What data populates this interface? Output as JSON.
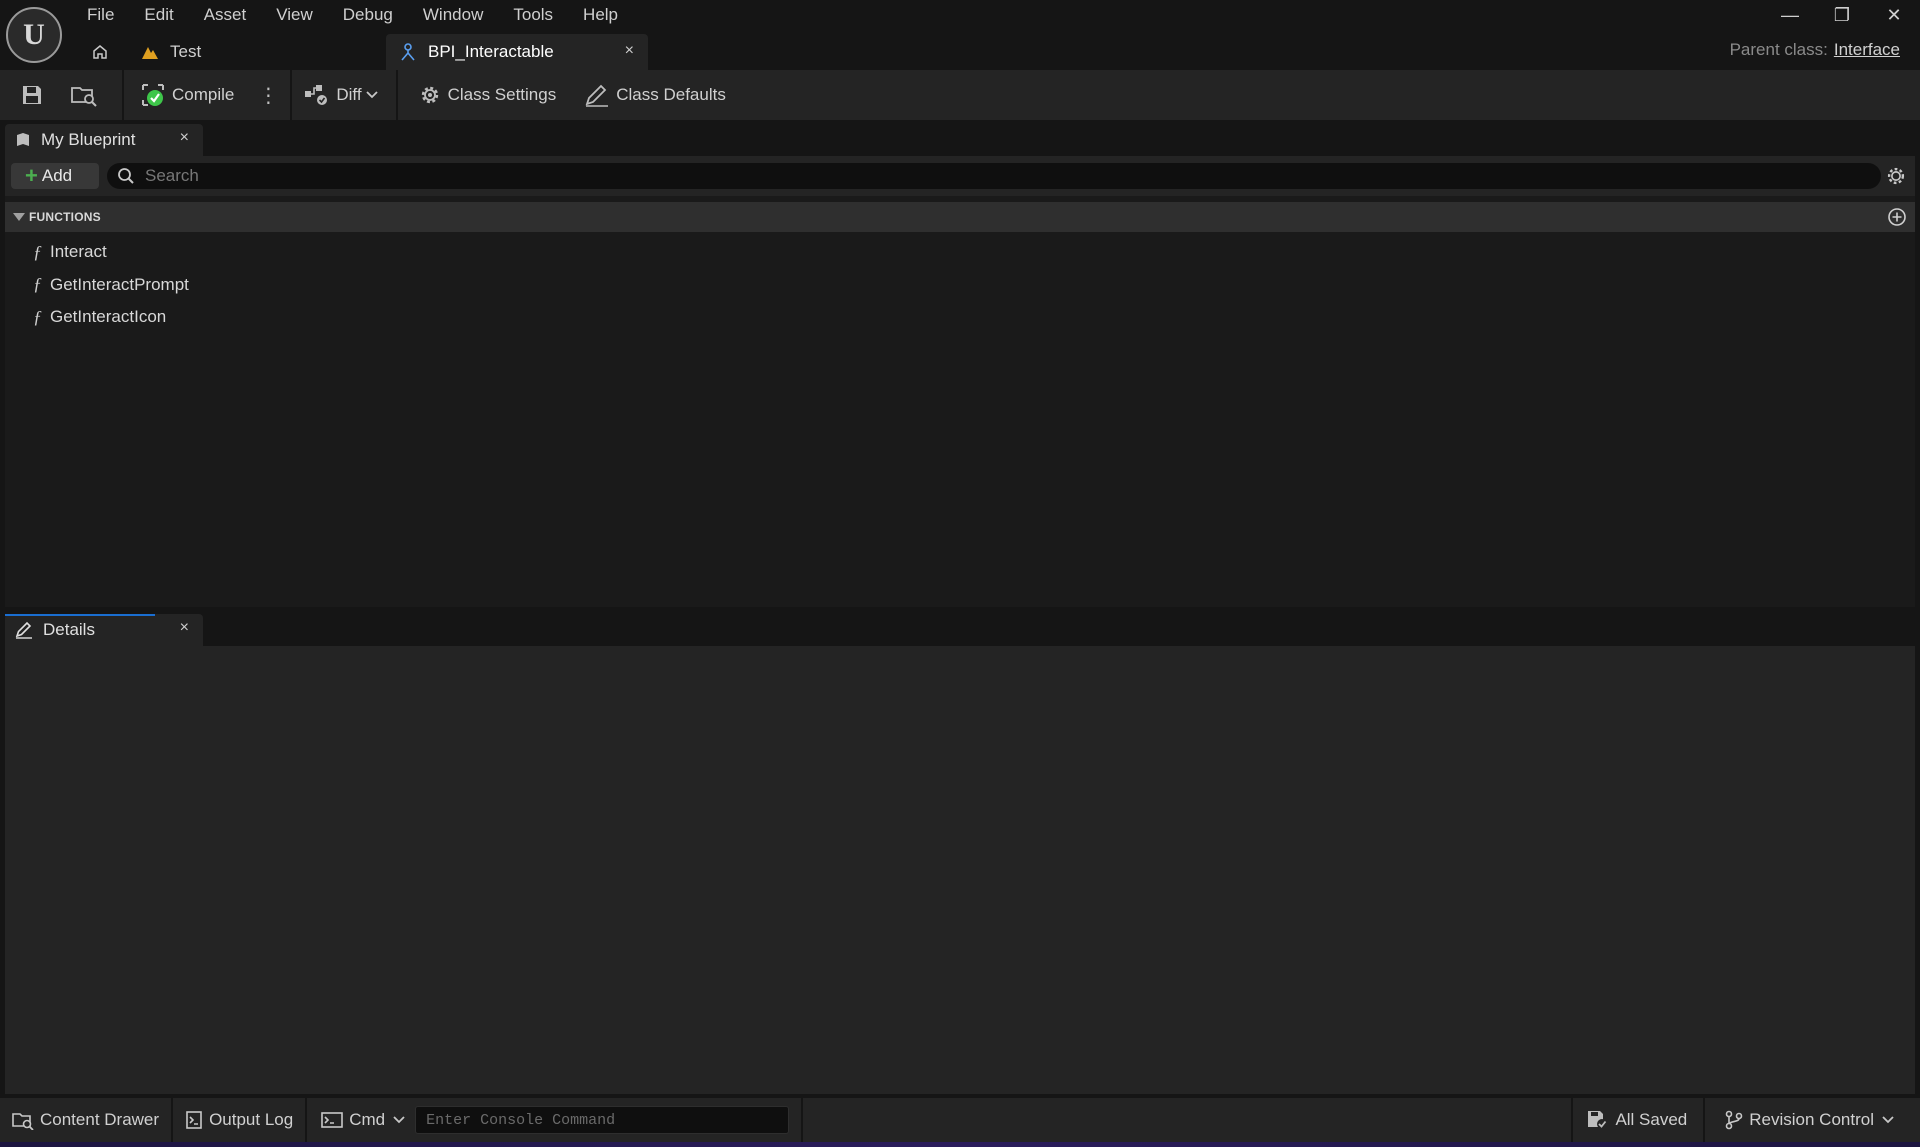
{
  "app": {
    "menu": [
      "File",
      "Edit",
      "Asset",
      "View",
      "Debug",
      "Window",
      "Tools",
      "Help"
    ],
    "window_controls": {
      "minimize": "—",
      "restore": "❐",
      "close": "✕"
    }
  },
  "tabs": {
    "test_label": "Test",
    "active_label": "BPI_Interactable",
    "close_glyph": "×"
  },
  "parent_class": {
    "label": "Parent class:",
    "value": "Interface"
  },
  "toolbar": {
    "compile_label": "Compile",
    "diff_label": "Diff",
    "class_settings_label": "Class Settings",
    "class_defaults_label": "Class Defaults"
  },
  "my_blueprint": {
    "tab_label": "My Blueprint",
    "add_label": "Add",
    "search_placeholder": "Search",
    "section_title": "FUNCTIONS",
    "functions": [
      "Interact",
      "GetInteractPrompt",
      "GetInteractIcon"
    ]
  },
  "details": {
    "tab_label": "Details"
  },
  "statusbar": {
    "content_drawer_label": "Content Drawer",
    "output_log_label": "Output Log",
    "cmd_label": "Cmd",
    "console_placeholder": "Enter Console Command",
    "all_saved_label": "All Saved",
    "revision_control_label": "Revision Control"
  },
  "colors": {
    "background": "#151515",
    "panel": "#242424",
    "panel_body": "#1a1a1a",
    "accent_blue": "#1a6ed1",
    "add_green": "#4caf50",
    "compile_green": "#3ec64a"
  }
}
